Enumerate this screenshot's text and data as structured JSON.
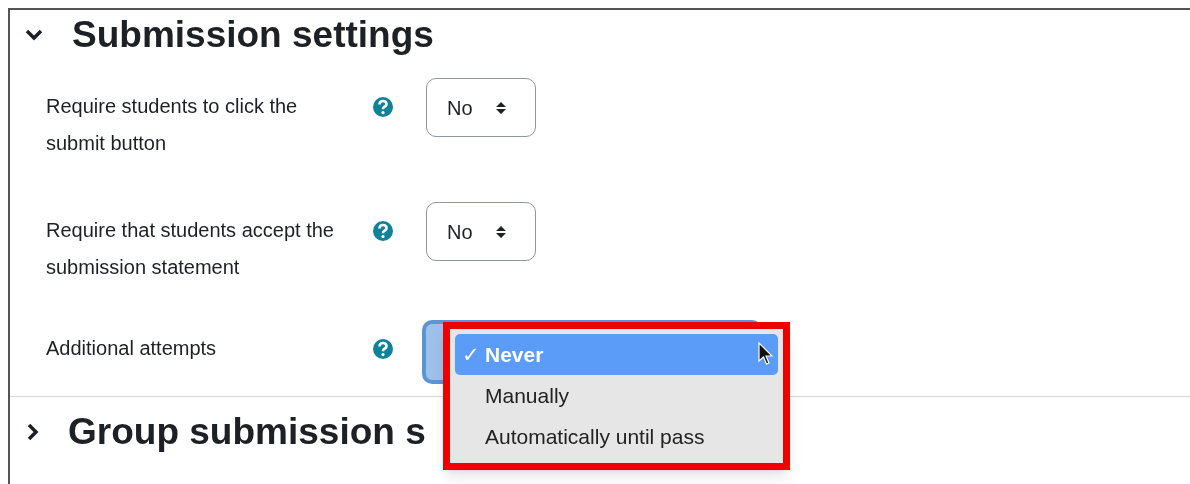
{
  "sections": [
    {
      "title": "Submission settings",
      "expanded": true
    },
    {
      "title": "Group submission s",
      "expanded": false
    }
  ],
  "fields": [
    {
      "kind": "select",
      "label": "Require students to click the submit button",
      "value": "No"
    },
    {
      "kind": "select",
      "label": "Require that students accept the submission statement",
      "value": "No"
    },
    {
      "kind": "open",
      "label": "Additional attempts"
    }
  ],
  "dropdown": {
    "options": [
      {
        "label": "Never",
        "selected": true
      },
      {
        "label": "Manually",
        "selected": false
      },
      {
        "label": "Automatically until pass",
        "selected": false
      }
    ],
    "check": "✓"
  }
}
